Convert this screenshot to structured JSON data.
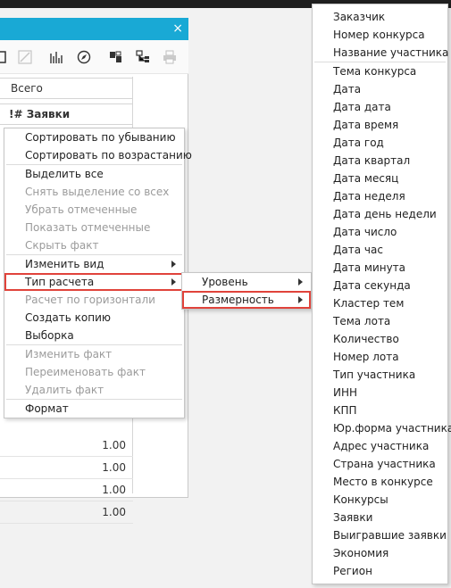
{
  "window": {
    "close_glyph": "×",
    "toolbar_icons": [
      "grid-icon",
      "edit-icon",
      "bar-chart-icon",
      "compass-icon",
      "copy-icon",
      "tree-icon",
      "print-icon"
    ],
    "header_total": "Всего",
    "header_measure": "Заявки",
    "measure_prefix": "!#",
    "values": [
      "1.00",
      "1.00",
      "1.00",
      "1.00"
    ]
  },
  "context_menu": {
    "sort_desc": "Сортировать по убыванию",
    "sort_asc": "Сортировать по возрастанию",
    "select_all": "Выделить все",
    "unselect_all": "Снять выделение со всех",
    "remove_marked": "Убрать отмеченные",
    "show_marked": "Показать отмеченные",
    "hide_fact": "Скрыть факт",
    "change_view": "Изменить вид",
    "calc_type": "Тип расчета",
    "calc_horizontal": "Расчет по горизонтали",
    "create_copy": "Создать копию",
    "selection": "Выборка",
    "edit_fact": "Изменить факт",
    "rename_fact": "Переименовать факт",
    "delete_fact": "Удалить факт",
    "format": "Формат"
  },
  "submenu": {
    "level": "Уровень",
    "dimension": "Размерность"
  },
  "dimension_list": {
    "top_items": [
      "Заказчик",
      "Номер конкурса",
      "Название участника"
    ],
    "items": [
      "Тема конкурса",
      "Дата",
      "Дата дата",
      "Дата время",
      "Дата год",
      "Дата квартал",
      "Дата месяц",
      "Дата неделя",
      "Дата день недели",
      "Дата число",
      "Дата час",
      "Дата минута",
      "Дата секунда",
      "Кластер тем",
      "Тема лота",
      "Количество",
      "Номер лота",
      "Тип участника",
      "ИНН",
      "КПП",
      "Юр.форма участника",
      "Адрес участника",
      "Страна участника",
      "Место в конкурсе",
      "Конкурсы",
      "Заявки",
      "Выигравшие заявки",
      "Экономия",
      "Регион"
    ]
  },
  "colors": {
    "title_bar": "#19a9d5",
    "highlight": "#e0433b"
  }
}
